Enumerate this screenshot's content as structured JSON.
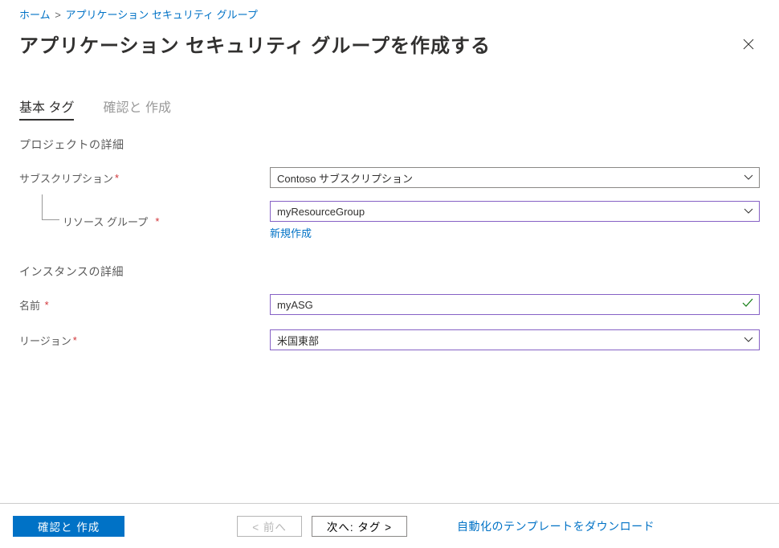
{
  "breadcrumb": {
    "home": "ホーム",
    "separator": ">",
    "current": "アプリケーション セキュリティ グループ"
  },
  "header": {
    "title": "アプリケーション セキュリティ グループを作成する"
  },
  "tabs": {
    "t0_a": "基本",
    "t0_b": "タグ",
    "t1_a": "確認と",
    "t1_b": "作成"
  },
  "sections": {
    "project_details": "プロジェクトの詳細",
    "instance_details": "インスタンスの詳細"
  },
  "fields": {
    "subscription": {
      "label": "サブスクリプション",
      "value": "Contoso サブスクリプション"
    },
    "resource_group": {
      "label": "リソース グループ",
      "value": "myResourceGroup",
      "create_new": "新規作成"
    },
    "name": {
      "label": "名前",
      "value": "myASG"
    },
    "region": {
      "label": "リージョン",
      "value": "米国東部"
    }
  },
  "footer": {
    "review_create": "確認と 作成",
    "previous": "< 前へ",
    "next": "次へ: タグ >",
    "download_template": "自動化のテンプレートをダウンロード"
  }
}
